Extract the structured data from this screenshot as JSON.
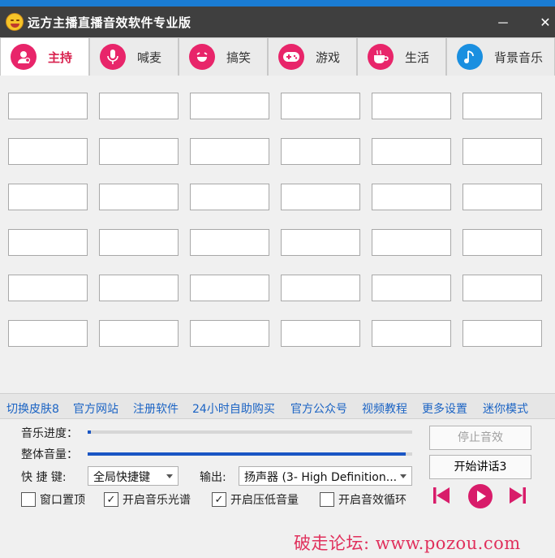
{
  "app": {
    "title": "远方主播直播音效软件专业版",
    "minimize": "－",
    "close": "✕"
  },
  "tabs": [
    {
      "label": "主持",
      "icon": "host-user-icon",
      "color": "#e8256a",
      "active": true
    },
    {
      "label": "喊麦",
      "icon": "microphone-icon",
      "color": "#e8256a"
    },
    {
      "label": "搞笑",
      "icon": "laughing-face-icon",
      "color": "#e8256a"
    },
    {
      "label": "游戏",
      "icon": "gamepad-icon",
      "color": "#e8256a"
    },
    {
      "label": "生活",
      "icon": "coffee-cup-icon",
      "color": "#e8256a"
    },
    {
      "label": "背景音乐",
      "icon": "music-note-icon",
      "color": "#1a8fe0"
    }
  ],
  "grid": {
    "rows": 6,
    "cols": 6
  },
  "links": [
    "切换皮肤8",
    "官方网站",
    "注册软件",
    "24小时自助购买",
    "官方公众号",
    "视频教程",
    "更多设置",
    "迷你模式"
  ],
  "controls": {
    "progress_label": "音乐进度：",
    "progress_value": 0.01,
    "volume_label": "整体音量：",
    "volume_value": 0.98,
    "hotkey_label": "快 捷 键:",
    "hotkey_value": "全局快捷键",
    "output_label": "输出:",
    "output_value": "扬声器 (3- High Definition...",
    "stop_button": "停止音效",
    "talk_button": "开始讲话3",
    "checkboxes": [
      {
        "label": "窗口置顶",
        "checked": false
      },
      {
        "label": "开启音乐光谱",
        "checked": true
      },
      {
        "label": "开启压低音量",
        "checked": true
      },
      {
        "label": "开启音效循环",
        "checked": false
      }
    ],
    "check_mark": "✓"
  },
  "player": {
    "prev": "previous-track-icon",
    "play": "play-icon",
    "next": "next-track-icon",
    "accent": "#d81c6a"
  },
  "watermark": "破走论坛: www.pozou.com"
}
